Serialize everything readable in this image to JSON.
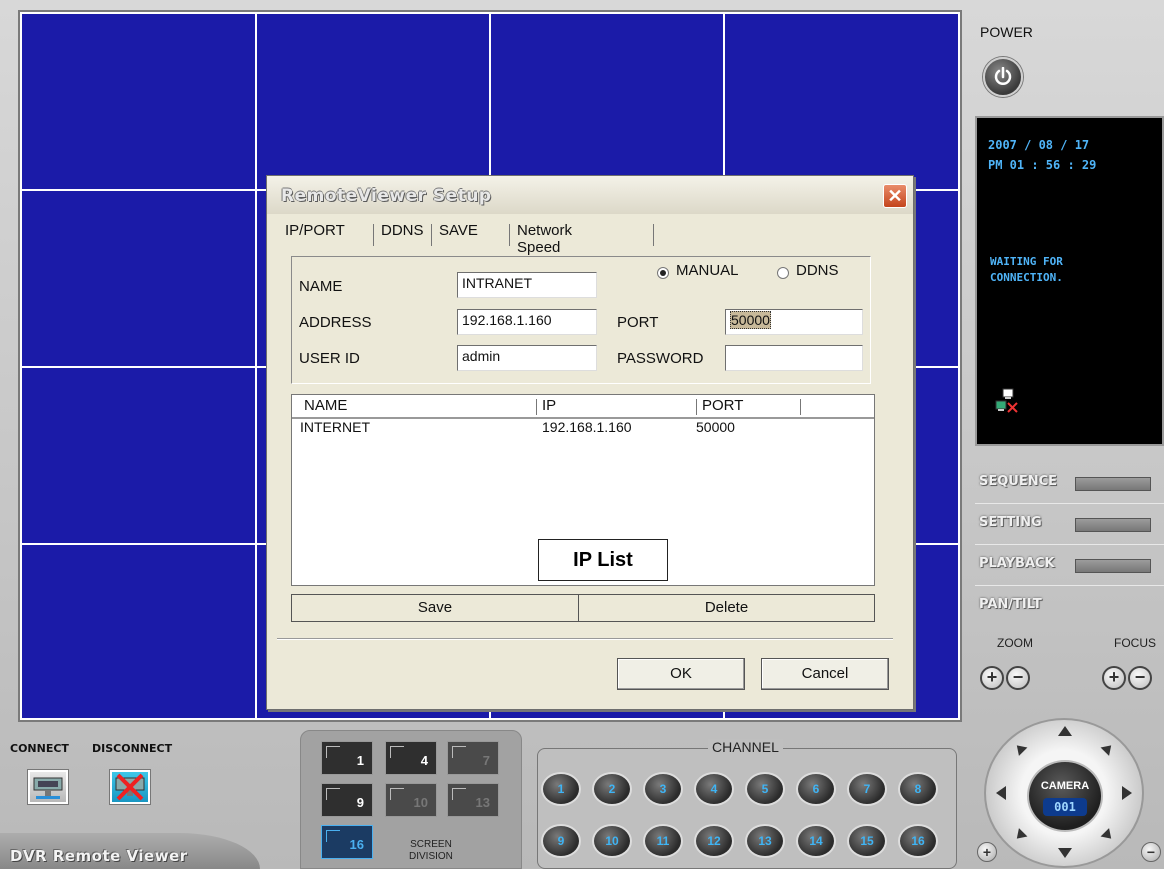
{
  "app": {
    "title": "DVR Remote Viewer"
  },
  "power": {
    "label": "POWER"
  },
  "status": {
    "date": "2007 / 08 / 17",
    "time": "PM 01 : 56 : 29",
    "message": "WAITING FOR CONNECTION."
  },
  "side_buttons": [
    "SEQUENCE",
    "SETTING",
    "PLAYBACK",
    "PAN/TILT"
  ],
  "zoom_label": "ZOOM",
  "focus_label": "FOCUS",
  "ptz": {
    "camera_label": "CAMERA",
    "camera_number": "001"
  },
  "connect": {
    "connect_label": "CONNECT",
    "disconnect_label": "DISCONNECT"
  },
  "screen_division": {
    "label_line1": "SCREEN",
    "label_line2": "DIVISION",
    "buttons": [
      "1",
      "4",
      "7",
      "9",
      "10",
      "13",
      "16"
    ],
    "active": "16"
  },
  "channel": {
    "label": "CHANNEL",
    "buttons": [
      "1",
      "2",
      "3",
      "4",
      "5",
      "6",
      "7",
      "8",
      "9",
      "10",
      "11",
      "12",
      "13",
      "14",
      "15",
      "16"
    ]
  },
  "dialog": {
    "title": "RemoteViewer Setup",
    "close": "✕",
    "tabs": [
      "IP/PORT",
      "DDNS",
      "SAVE",
      "Network Speed"
    ],
    "name_label": "NAME",
    "name_value": "INTRANET",
    "mode_manual": "MANUAL",
    "mode_ddns": "DDNS",
    "mode_selected": "MANUAL",
    "address_label": "ADDRESS",
    "address_value": "192.168.1.160",
    "port_label": "PORT",
    "port_value": "50000",
    "userid_label": "USER ID",
    "userid_value": "admin",
    "password_label": "PASSWORD",
    "password_value": "",
    "list_headers": [
      "NAME",
      "IP",
      "PORT"
    ],
    "list_rows": [
      {
        "name": "INTERNET",
        "ip": "192.168.1.160",
        "port": "50000"
      }
    ],
    "list_tag": "IP List",
    "save_label": "Save",
    "delete_label": "Delete",
    "ok_label": "OK",
    "cancel_label": "Cancel"
  },
  "colors": {
    "video_bg": "#1b1ba8",
    "status_text": "#4fb4f8",
    "dialog_bg": "#ece9d8"
  }
}
